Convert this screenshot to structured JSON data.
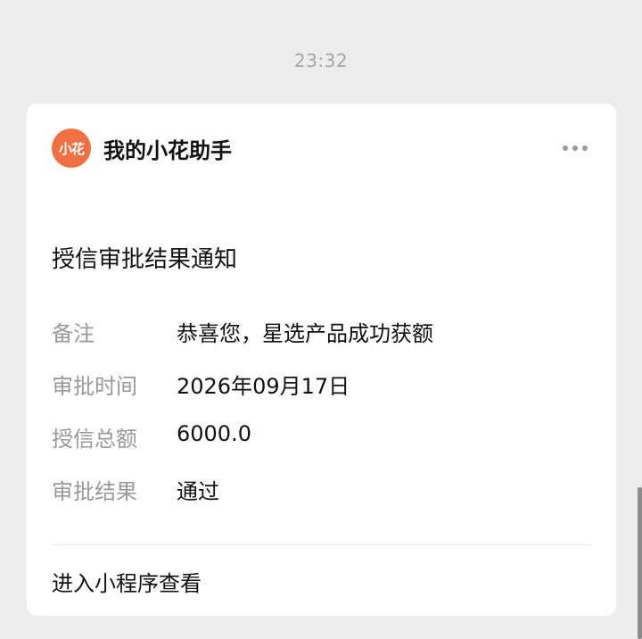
{
  "timestamp": "23:32",
  "card": {
    "logo_text": "小花",
    "account_name": "我的小花助手",
    "title": "授信审批结果通知",
    "rows": [
      {
        "label": "备注",
        "value": "恭喜您，星选产品成功获额"
      },
      {
        "label": "审批时间",
        "value": "2026年09月17日"
      },
      {
        "label": "授信总额",
        "value": "6000.0"
      },
      {
        "label": "审批结果",
        "value": "通过"
      }
    ],
    "footer_link": "进入小程序查看"
  },
  "colors": {
    "background": "#ededed",
    "card": "#ffffff",
    "logo": "#ee7043",
    "label": "#999999",
    "text": "#111111"
  },
  "icons": {
    "more": "more-dots-icon"
  }
}
